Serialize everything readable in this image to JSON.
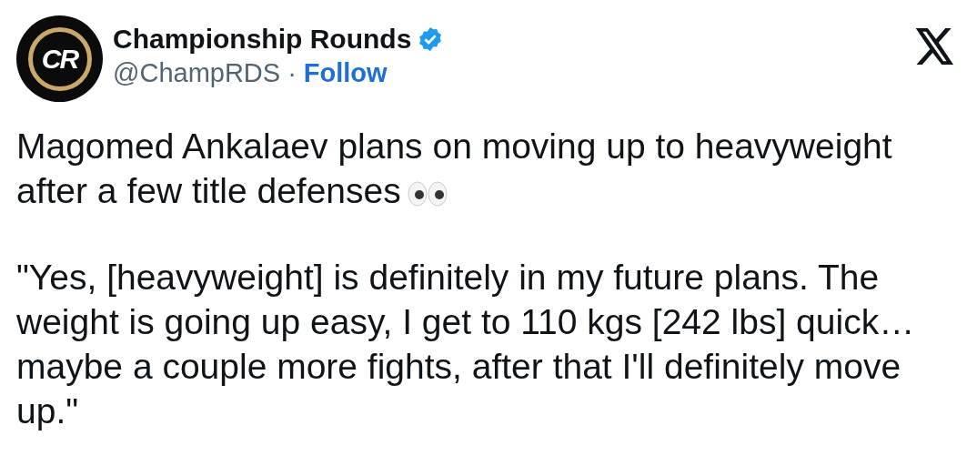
{
  "author": {
    "avatar_text": "CR",
    "name": "Championship Rounds",
    "verified": true,
    "handle": "@ChampRDS",
    "separator": "·",
    "follow": "Follow"
  },
  "paragraphs": [
    {
      "lines": [
        "Magomed Ankalaev plans on moving up to heavyweight",
        "after a few title defenses"
      ],
      "kind": "eyes-ending"
    },
    {
      "kind": "plain",
      "lines": [
        "\"Yes, [heavyweight] is definitely in my future plans. The",
        "weight is going up easy, I get to 110 kgs [242 lbs] quick…",
        "maybe a couple more fights, after that I'll definitely move",
        "up.\""
      ]
    }
  ]
}
